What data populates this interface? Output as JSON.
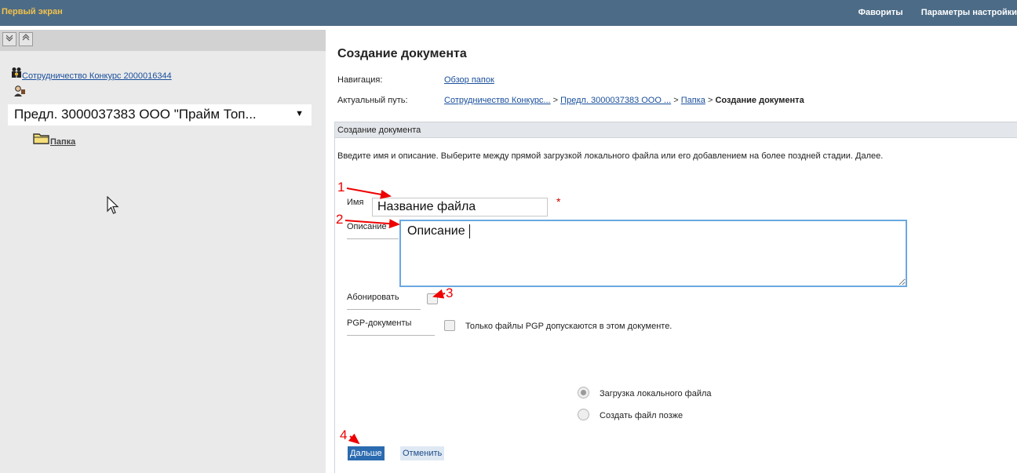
{
  "topbar": {
    "title": "Первый экран",
    "links": [
      "Фавориты",
      "Параметры настройки"
    ]
  },
  "sidebar": {
    "toolbar": [
      "collapse-all-icon",
      "expand-all-icon"
    ],
    "tree": {
      "root_label": "Сотрудничество Конкурс 2000016344",
      "selected_item": "Предл. 3000037383 ООО \"Прайм Топ...",
      "folder_label": "Папка"
    }
  },
  "main": {
    "title": "Создание документа",
    "nav_label": "Навигация:",
    "nav_link": "Обзор папок",
    "path_label": "Актуальный путь:",
    "path": [
      "Сотрудничество Конкурс...",
      "Предл. 3000037383 ООО ...",
      "Папка"
    ],
    "path_current": "Создание документа",
    "path_sep": ">",
    "section_title": "Создание документа",
    "description": "Введите имя и описание. Выберите между прямой загрузкой локального файла или его добавлением на более поздней стадии. Далее.",
    "form": {
      "name_label": "Имя",
      "name_value": "Название файла",
      "required_mark": "*",
      "description_label": "Описание",
      "description_value": "Описание",
      "subscribe_label": "Абонировать",
      "subscribe_checked": false,
      "pgp_label": "PGP-документы",
      "pgp_checked": false,
      "pgp_text": "Только файлы PGP допускаются в этом документе.",
      "options": [
        "Загрузка локального файла",
        "Создать файл позже"
      ],
      "selected_option": "Загрузка локального файла"
    },
    "buttons": {
      "next": "Дальше",
      "cancel": "Отменить"
    }
  },
  "annotations": [
    "1",
    "2",
    "3",
    "4"
  ],
  "colors": {
    "topbar": "#4c6b86",
    "brand": "#f2c24b",
    "annotation": "#ee0000",
    "primary_button": "#2b6bb0"
  }
}
